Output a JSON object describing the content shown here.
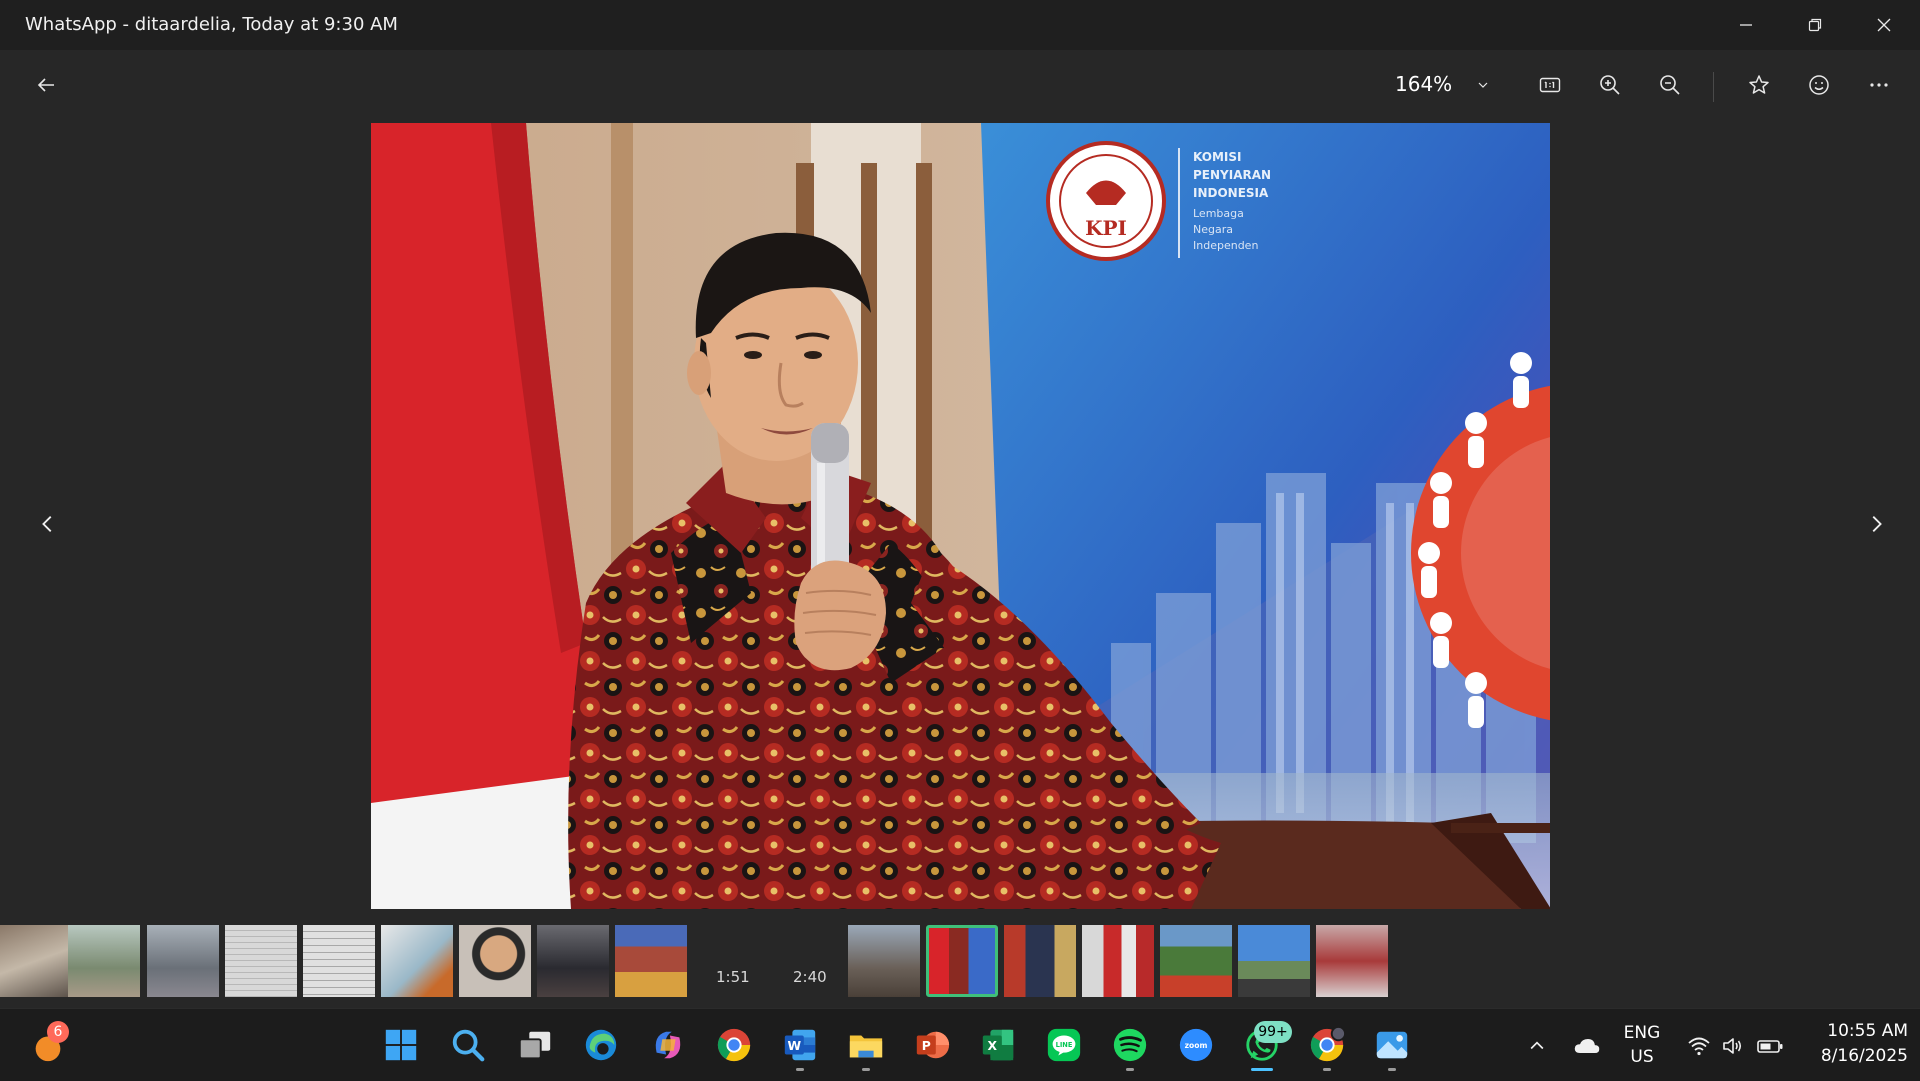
{
  "window": {
    "title": "WhatsApp - ditaardelia, Today at 9:30 AM"
  },
  "toolbar": {
    "zoom_level": "164%"
  },
  "photo": {
    "banner_logo_text": "KPI",
    "banner_org_lines": [
      "KOMISI",
      "PENYIARAN",
      "INDONESIA"
    ],
    "banner_tagline_lines": [
      "Lembaga",
      "Negara",
      "Independen"
    ]
  },
  "filmstrip": {
    "video_durations": [
      "1:51",
      "2:40"
    ],
    "selected_index": 12
  },
  "taskbar": {
    "notification_badge": "6",
    "whatsapp_badge": "99+",
    "zoom_app_label": "zoom",
    "language_line1": "ENG",
    "language_line2": "US",
    "time": "10:55 AM",
    "date": "8/16/2025"
  },
  "colors": {
    "window_bg": "#272727",
    "taskbar_bg": "#1c1c1c",
    "accent_selected": "#3fc07a",
    "taskbar_active": "#4cc2ff",
    "badge_teal": "#7ee0c4",
    "badge_red": "#ff6a5a"
  }
}
